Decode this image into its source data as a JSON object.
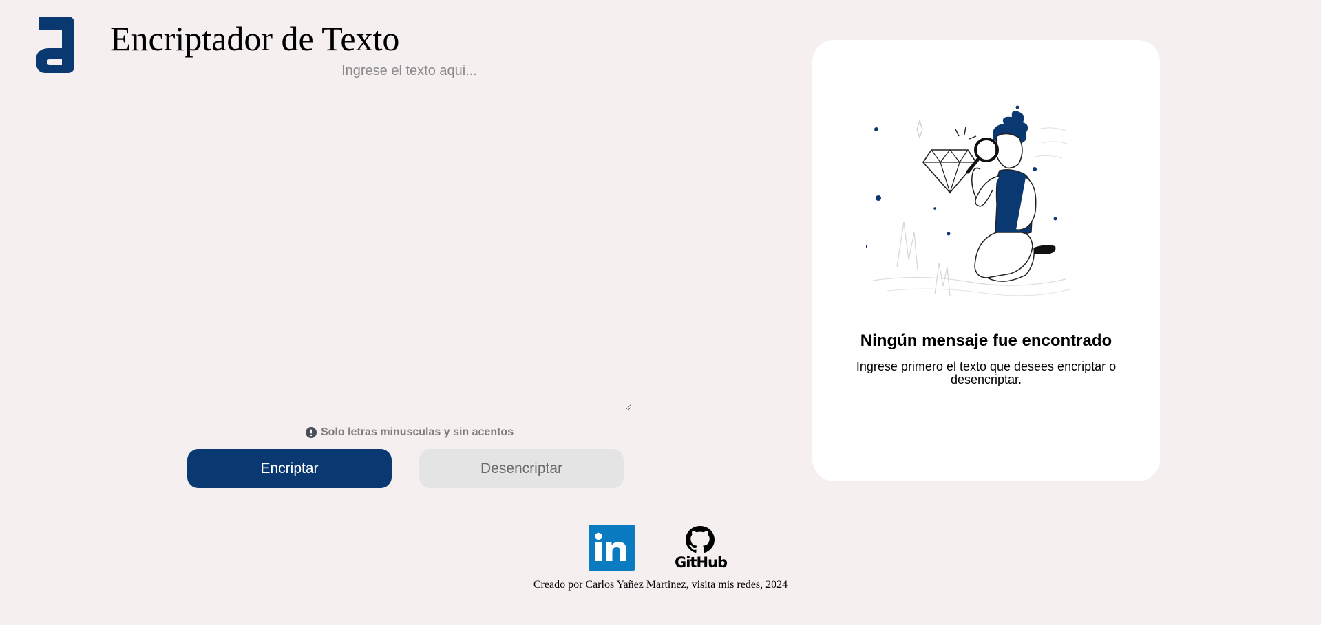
{
  "header": {
    "logo_icon": "alura-a-logo-icon",
    "title": "Encriptador de Texto"
  },
  "input": {
    "placeholder": "Ingrese el texto aqui...",
    "value": ""
  },
  "hint": {
    "icon": "exclamation-circle-icon",
    "text": "Solo letras minusculas y sin acentos"
  },
  "buttons": {
    "encrypt_label": "Encriptar",
    "decrypt_label": "Desencriptar"
  },
  "result": {
    "illustration_icon": "person-searching-diamond-illustration",
    "title": "Ningún mensaje fue encontrado",
    "text": "Ingrese primero el texto que desees encriptar o desencriptar."
  },
  "footer": {
    "linkedin_icon": "linkedin-icon",
    "github_icon": "github-icon",
    "github_label": "GitHub",
    "credit": "Creado por Carlos Yañez Martinez, visita mis redes, 2024"
  },
  "colors": {
    "background": "#f5eff0",
    "primary": "#0a3871",
    "secondary_button": "#e4e4e4",
    "linkedin": "#0a7bc1"
  }
}
